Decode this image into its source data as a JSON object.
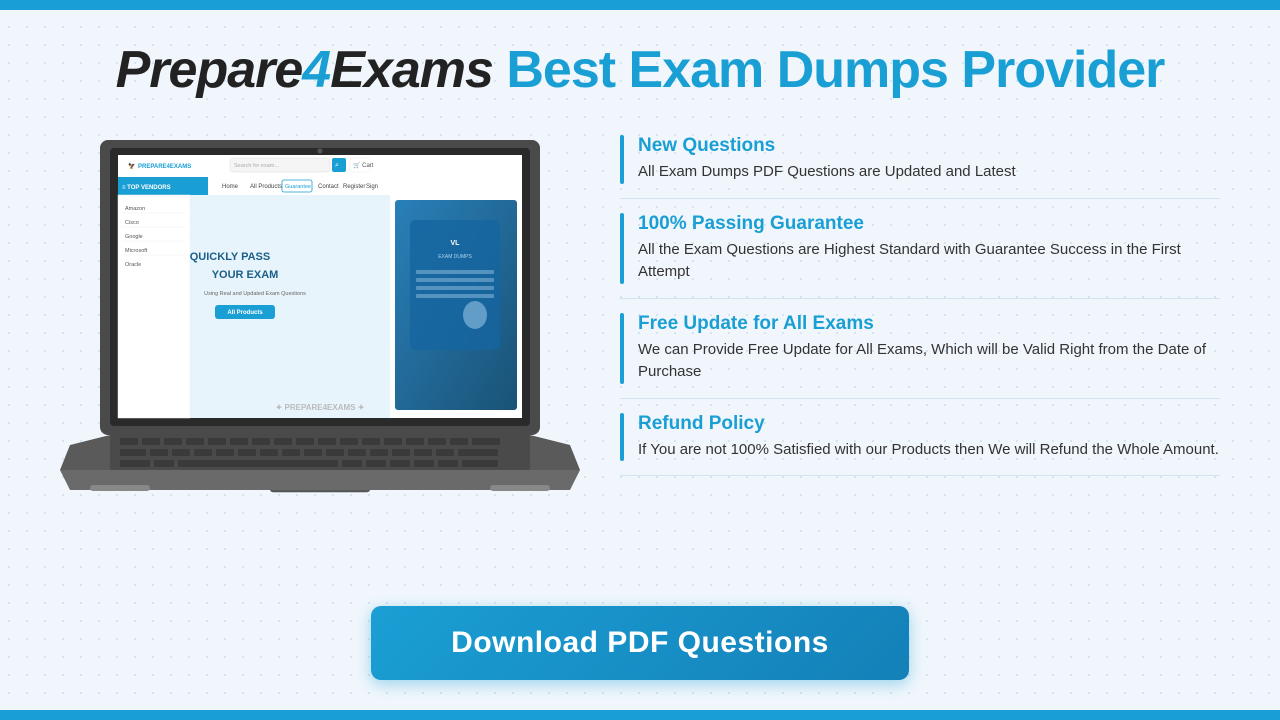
{
  "header": {
    "brand_black": "Prepare",
    "brand_four": "4",
    "brand_suffix_black": "Exams",
    "subtitle": "Best Exam Dumps Provider"
  },
  "features": [
    {
      "id": "new-questions",
      "title": "New Questions",
      "description": "All Exam Dumps PDF Questions are Updated and Latest"
    },
    {
      "id": "passing-guarantee",
      "title": "100% Passing Guarantee",
      "description": "All the Exam Questions are Highest Standard with Guarantee Success in the First Attempt"
    },
    {
      "id": "free-update",
      "title": "Free Update for All Exams",
      "description": "We can Provide Free Update for All Exams, Which will be Valid Right from the Date of Purchase"
    },
    {
      "id": "refund-policy",
      "title": "Refund Policy",
      "description": "If You are not 100% Satisfied with our Products then We will Refund the Whole Amount."
    }
  ],
  "download_btn": {
    "label": "Download PDF Questions"
  },
  "laptop_screen": {
    "search_placeholder": "Search for exam...",
    "nav_links": [
      "Home",
      "All Products",
      "Guarantee",
      "Contact",
      "Register",
      "Sign"
    ],
    "sidebar_items": [
      "Amazon",
      "Cisco",
      "Google",
      "Microsoft",
      "Oracle"
    ],
    "hero_title": "QUICKLY PASS\nYOUR EXAM",
    "hero_subtitle": "Using Real and Updated Exam Questions",
    "all_products_btn": "All Products",
    "watermark": "PREPARE4EXAMS"
  },
  "colors": {
    "accent": "#1a9fd4",
    "black": "#222222",
    "text_dark": "#333333",
    "bg": "#f0f6fc",
    "bar": "#1a9fd4"
  }
}
